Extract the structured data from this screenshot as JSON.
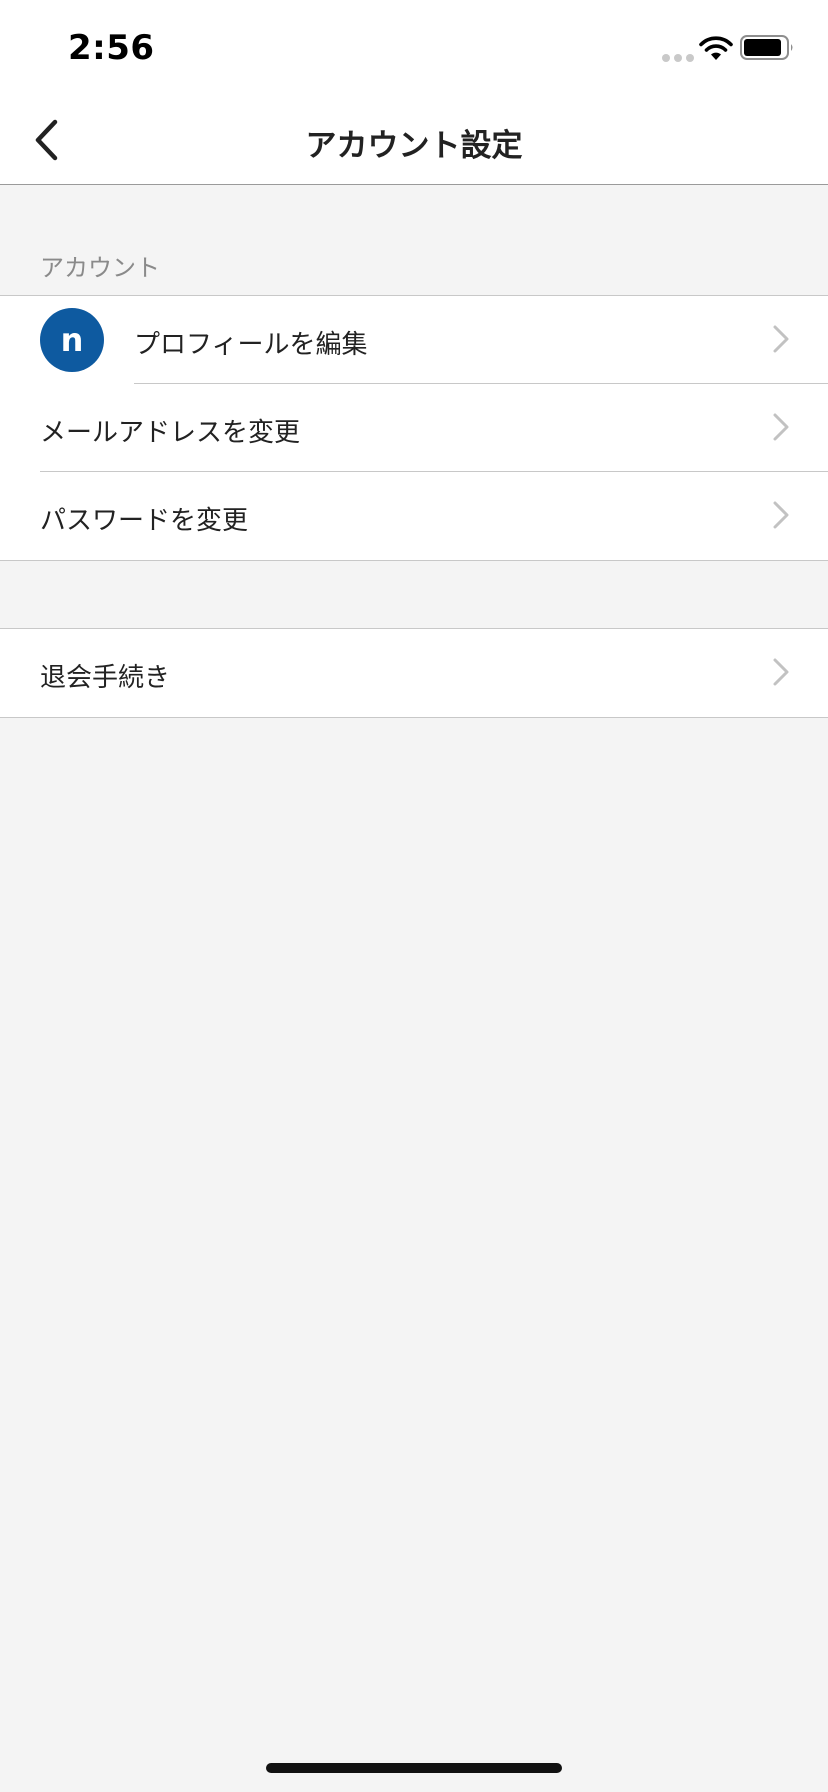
{
  "status_bar": {
    "time": "2:56",
    "icons": [
      "signal-dots-icon",
      "wifi-icon",
      "battery-icon"
    ]
  },
  "nav": {
    "title": "アカウント設定",
    "back_icon": "chevron-left-icon"
  },
  "sections": [
    {
      "header": "アカウント",
      "items": [
        {
          "label": "プロフィールを編集",
          "avatar_letter": "n",
          "icon": "chevron-right-icon"
        },
        {
          "label": "メールアドレスを変更",
          "icon": "chevron-right-icon"
        },
        {
          "label": "パスワードを変更",
          "icon": "chevron-right-icon"
        }
      ]
    },
    {
      "header": "",
      "items": [
        {
          "label": "退会手続き",
          "icon": "chevron-right-icon"
        }
      ]
    }
  ],
  "colors": {
    "avatar_bg": "#0e5aa0",
    "background": "#f4f4f4",
    "section_header": "#8a8a8a",
    "separator": "#c8c8c8"
  }
}
